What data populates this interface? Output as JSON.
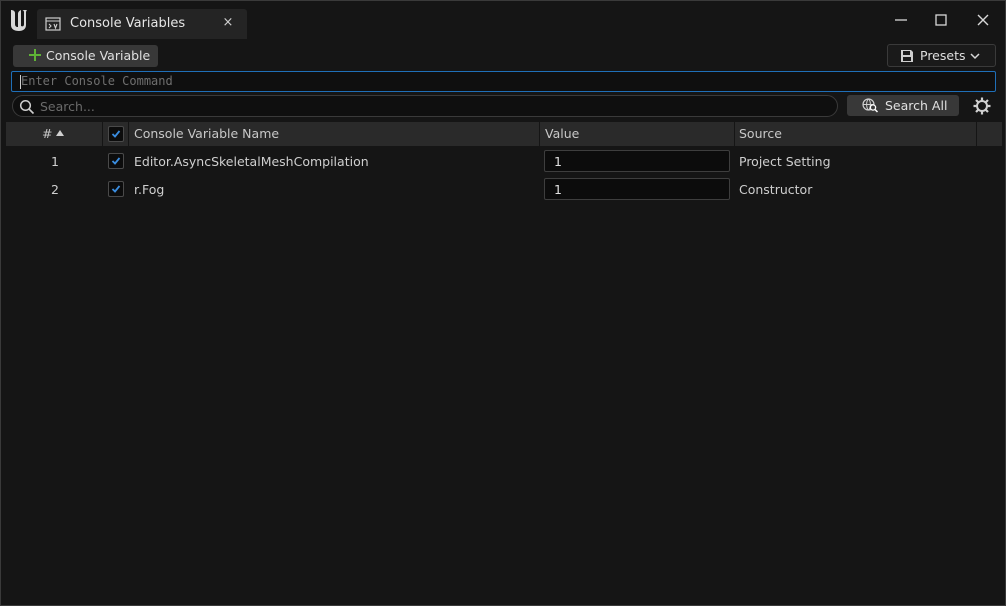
{
  "window": {
    "tab_title": "Console Variables",
    "close_tab_glyph": "×"
  },
  "toolbar": {
    "add_label": "Console Variable",
    "presets_label": "Presets"
  },
  "command": {
    "placeholder": "Enter Console Command",
    "value": ""
  },
  "search": {
    "placeholder": "Search...",
    "search_all_label": "Search All"
  },
  "table": {
    "columns": {
      "index": "#",
      "name": "Console Variable Name",
      "value": "Value",
      "source": "Source"
    },
    "rows": [
      {
        "index": "1",
        "checked": true,
        "name": "Editor.AsyncSkeletalMeshCompilation",
        "value": "1",
        "source": "Project Setting"
      },
      {
        "index": "2",
        "checked": true,
        "name": "r.Fog",
        "value": "1",
        "source": "Constructor"
      }
    ]
  },
  "colors": {
    "accent": "#1f6fb8",
    "check": "#3a8de0",
    "add_plus": "#5fb336"
  },
  "icons": [
    "unreal-logo-icon",
    "console-icon",
    "close-icon",
    "minimize-icon",
    "maximize-icon",
    "plus-icon",
    "save-icon",
    "chevron-down-icon",
    "search-icon",
    "globe-search-icon",
    "gear-icon",
    "sort-ascending-icon",
    "checkmark-icon"
  ]
}
